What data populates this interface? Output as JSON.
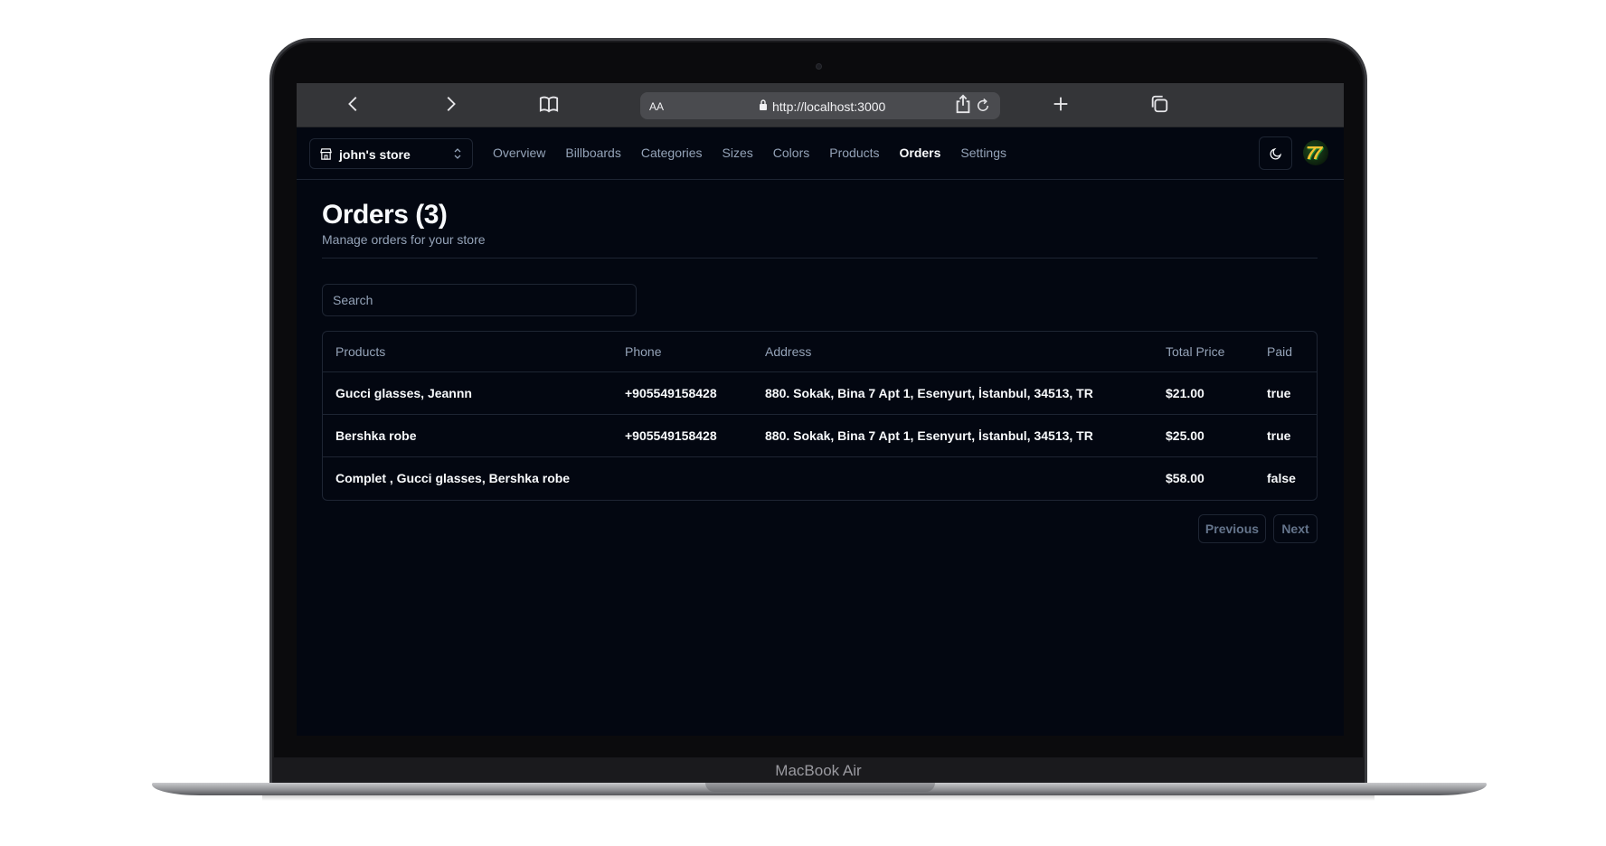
{
  "device": {
    "label": "MacBook Air"
  },
  "browser": {
    "text_size_label": "AA",
    "url": "http://localhost:3000"
  },
  "nav": {
    "store_name": "john's store",
    "links": [
      "Overview",
      "Billboards",
      "Categories",
      "Sizes",
      "Colors",
      "Products",
      "Orders",
      "Settings"
    ],
    "active": "Orders"
  },
  "page": {
    "title": "Orders (3)",
    "subtitle": "Manage orders for your store"
  },
  "search": {
    "placeholder": "Search",
    "value": ""
  },
  "table": {
    "columns": [
      "Products",
      "Phone",
      "Address",
      "Total Price",
      "Paid"
    ],
    "rows": [
      {
        "products": "Gucci glasses, Jeannn",
        "phone": "+905549158428",
        "address": "880. Sokak, Bina 7 Apt 1, Esenyurt, İstanbul, 34513, TR",
        "total": "$21.00",
        "paid": "true"
      },
      {
        "products": "Bershka robe",
        "phone": "+905549158428",
        "address": "880. Sokak, Bina 7 Apt 1, Esenyurt, İstanbul, 34513, TR",
        "total": "$25.00",
        "paid": "true"
      },
      {
        "products": "Complet , Gucci glasses, Bershka robe",
        "phone": "",
        "address": "",
        "total": "$58.00",
        "paid": "false"
      }
    ]
  },
  "pagination": {
    "previous_label": "Previous",
    "next_label": "Next"
  },
  "colors": {
    "background": "#030711",
    "border": "#1e2533",
    "text": "#f8fafc",
    "muted_text": "#94a3b8",
    "browser_bar": "#343538"
  }
}
